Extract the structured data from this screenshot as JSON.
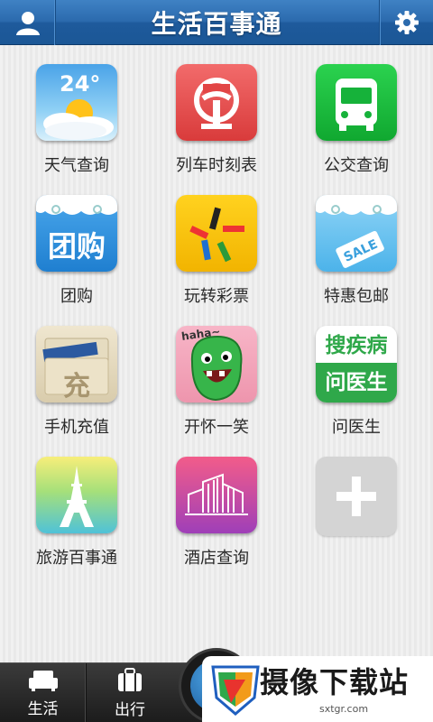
{
  "header": {
    "title": "生活百事通",
    "left_icon": "user-icon",
    "right_icon": "gear-icon"
  },
  "apps": [
    {
      "label": "天气查询",
      "icon": "weather-icon",
      "text": "24°"
    },
    {
      "label": "列车时刻表",
      "icon": "train-icon"
    },
    {
      "label": "公交查询",
      "icon": "bus-icon"
    },
    {
      "label": "团购",
      "icon": "group-buy-icon",
      "text": "团购"
    },
    {
      "label": "玩转彩票",
      "icon": "lottery-icon"
    },
    {
      "label": "特惠包邮",
      "icon": "sale-tag-icon",
      "text": "SALE"
    },
    {
      "label": "手机充值",
      "icon": "recharge-icon",
      "text": "充"
    },
    {
      "label": "开怀一笑",
      "icon": "laugh-icon",
      "text": "haha~"
    },
    {
      "label": "问医生",
      "icon": "doctor-icon",
      "text_top": "搜疾病",
      "text_bottom": "问医生"
    },
    {
      "label": "旅游百事通",
      "icon": "eiffel-tower-icon"
    },
    {
      "label": "酒店查询",
      "icon": "hotel-icon"
    },
    {
      "label": "",
      "icon": "add-icon"
    }
  ],
  "tabbar": {
    "tabs": [
      {
        "label": "生活",
        "icon": "sofa-icon"
      },
      {
        "label": "出行",
        "icon": "luggage-icon"
      }
    ]
  },
  "watermark": {
    "name": "摄像下载站",
    "url": "sxtgr.com"
  },
  "colors": {
    "header": "#2b6aad",
    "tabbar": "#2a2a2a",
    "accent_green": "#2fa84a"
  }
}
